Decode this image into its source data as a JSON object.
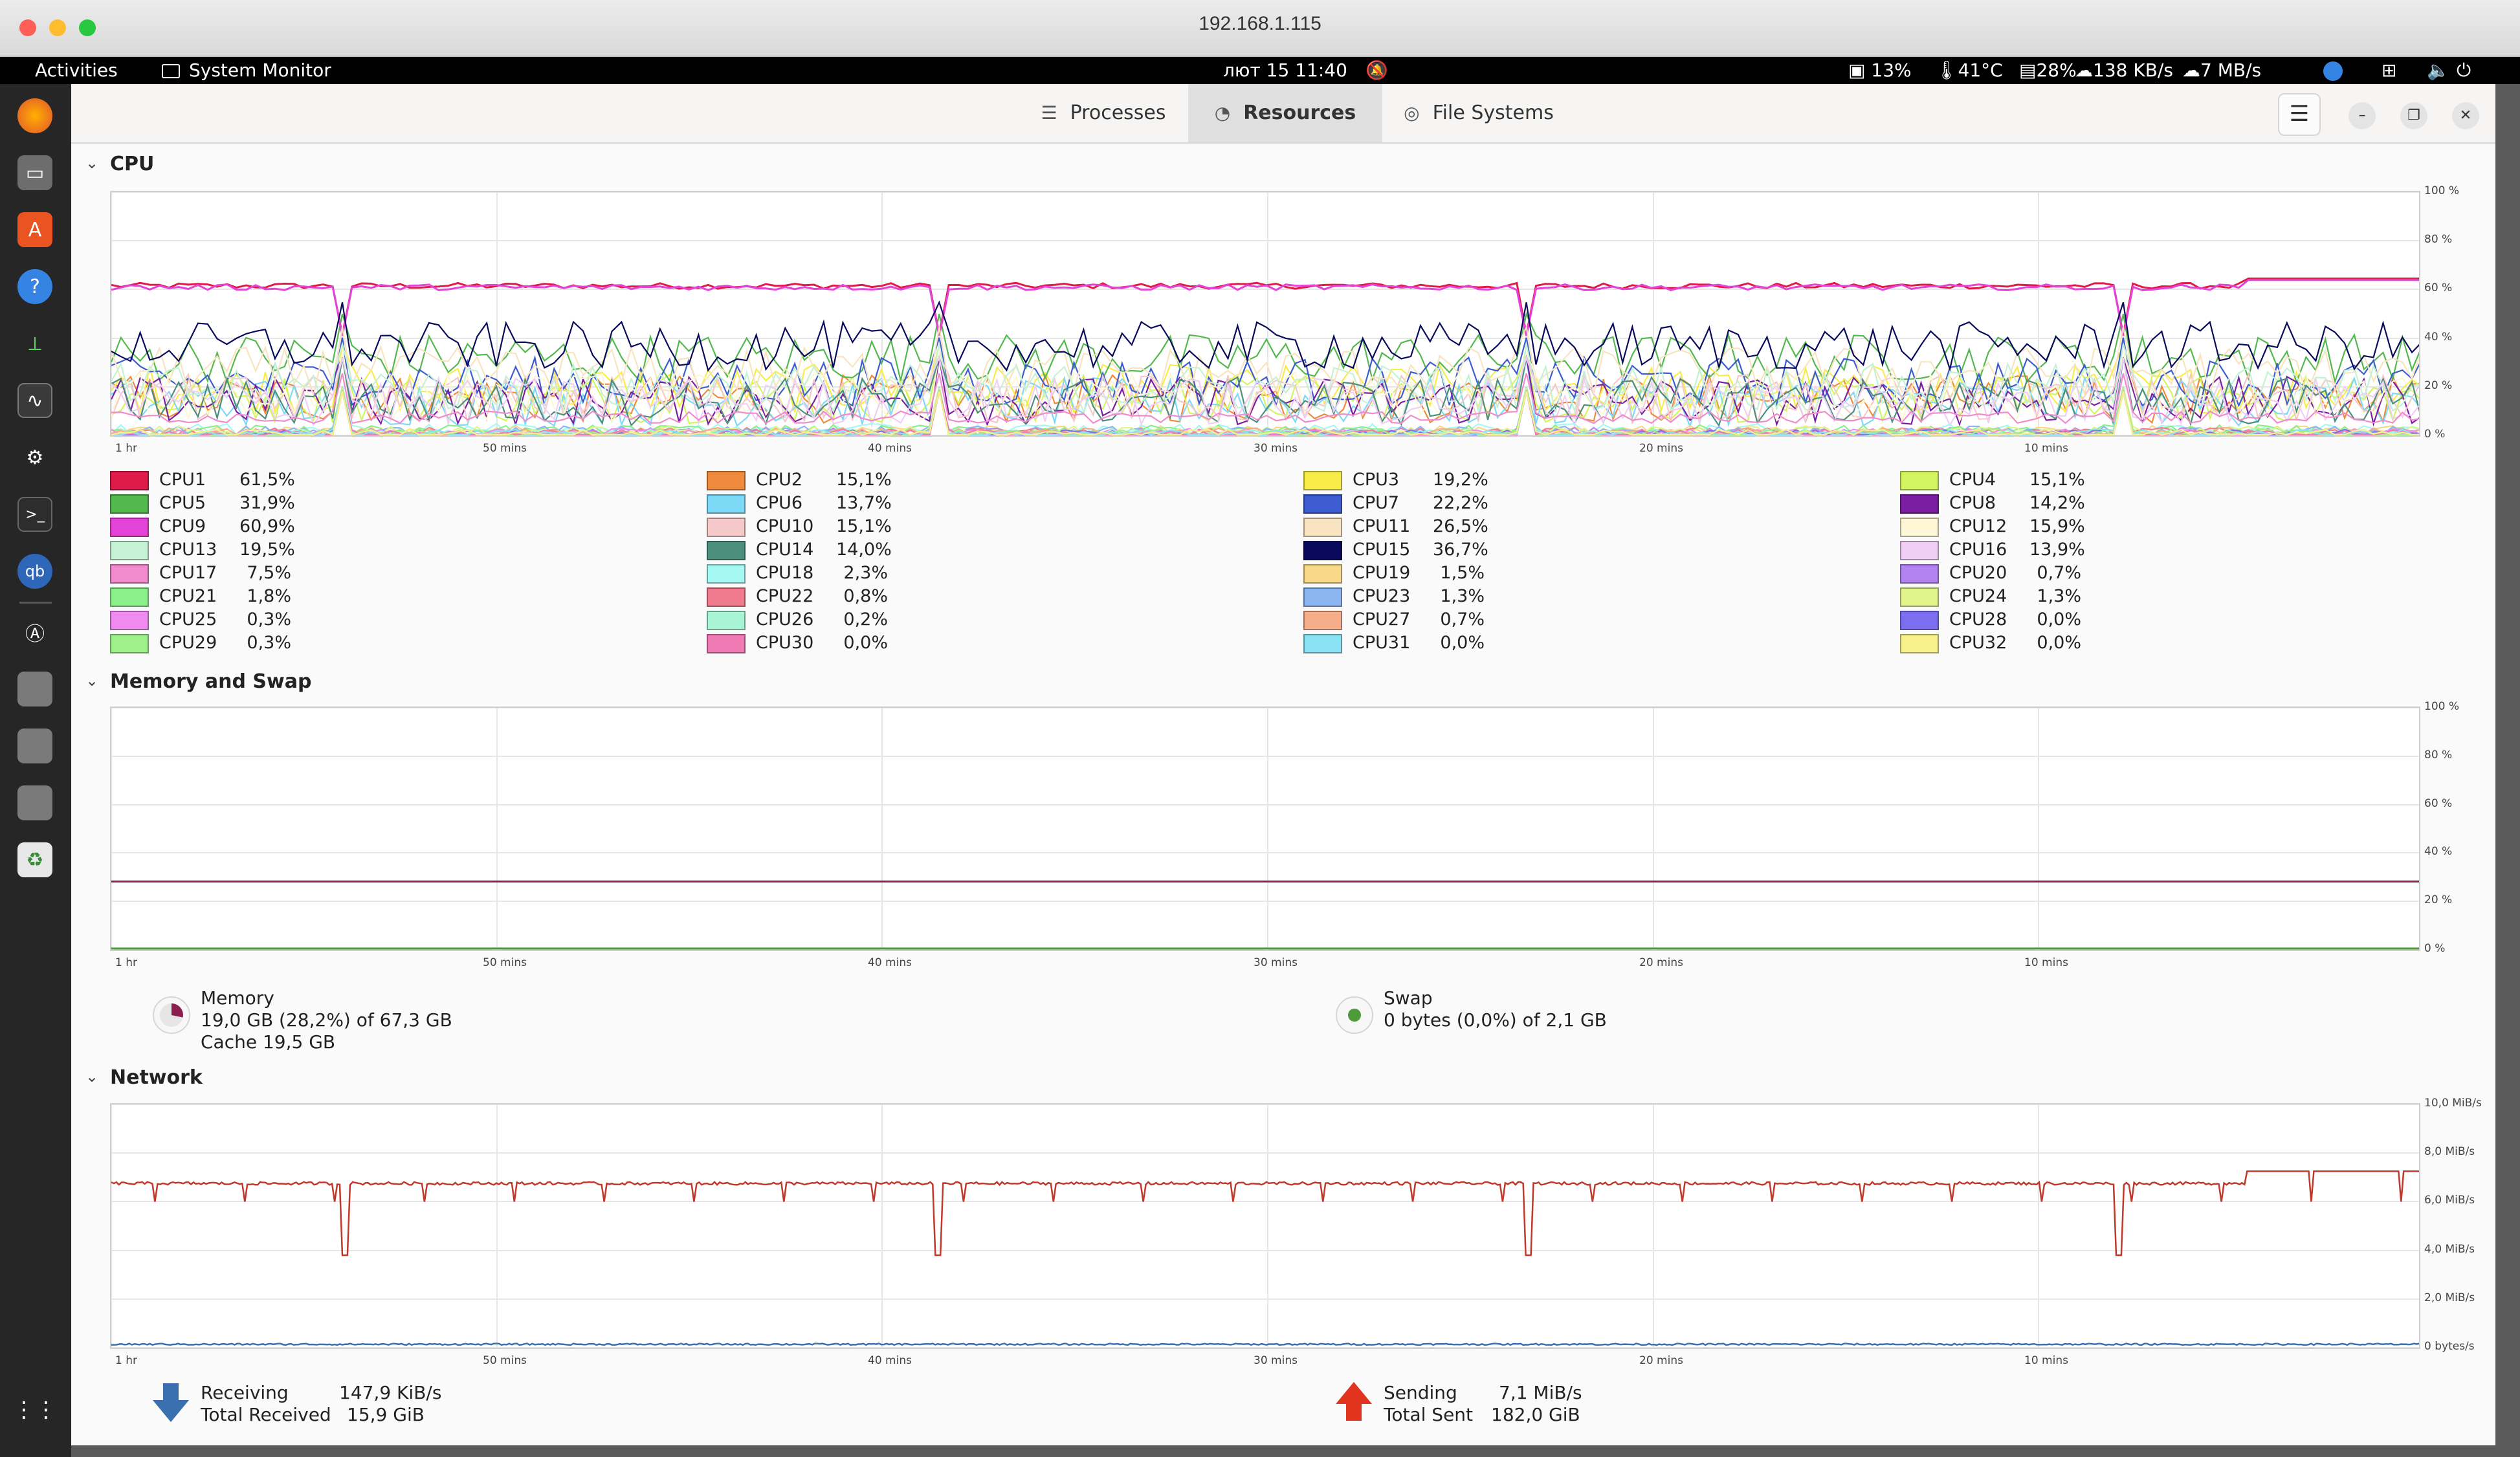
{
  "mac_window": {
    "title": "192.168.1.115"
  },
  "topbar": {
    "activities": "Activities",
    "app_name": "System Monitor",
    "datetime": "лют 15  11:40",
    "indicators": {
      "disk": "13%",
      "temp": "41°C",
      "cpu": "28%",
      "net_down": "138 KB/s",
      "net_up": "7 MB/s"
    }
  },
  "tabs": [
    {
      "label": "Processes"
    },
    {
      "label": "Resources"
    },
    {
      "label": "File Systems"
    }
  ],
  "cpu": {
    "title": "CPU",
    "y_ticks": [
      "100 %",
      "80 %",
      "60 %",
      "40 %",
      "20 %",
      "0 %"
    ],
    "x_ticks": [
      "1 hr",
      "50 mins",
      "40 mins",
      "30 mins",
      "20 mins",
      "10 mins"
    ],
    "cores": [
      {
        "name": "CPU1",
        "value": "61,5%",
        "color": "#e01b4c"
      },
      {
        "name": "CPU2",
        "value": "15,1%",
        "color": "#f08a3c"
      },
      {
        "name": "CPU3",
        "value": "19,2%",
        "color": "#f8ed48"
      },
      {
        "name": "CPU4",
        "value": "15,1%",
        "color": "#d2f560"
      },
      {
        "name": "CPU5",
        "value": "31,9%",
        "color": "#53b84d"
      },
      {
        "name": "CPU6",
        "value": "13,7%",
        "color": "#7ed9f7"
      },
      {
        "name": "CPU7",
        "value": "22,2%",
        "color": "#3c5cd0"
      },
      {
        "name": "CPU8",
        "value": "14,2%",
        "color": "#7a1fa2"
      },
      {
        "name": "CPU9",
        "value": "60,9%",
        "color": "#e343d6"
      },
      {
        "name": "CPU10",
        "value": "15,1%",
        "color": "#f5c9c9"
      },
      {
        "name": "CPU11",
        "value": "26,5%",
        "color": "#f8e4c0"
      },
      {
        "name": "CPU12",
        "value": "15,9%",
        "color": "#fdf7d6"
      },
      {
        "name": "CPU13",
        "value": "19,5%",
        "color": "#c5f2d4"
      },
      {
        "name": "CPU14",
        "value": "14,0%",
        "color": "#4c8f7d"
      },
      {
        "name": "CPU15",
        "value": "36,7%",
        "color": "#0a0a5c"
      },
      {
        "name": "CPU16",
        "value": "13,9%",
        "color": "#f0cff5"
      },
      {
        "name": "CPU17",
        "value": "7,5%",
        "color": "#f08ccd"
      },
      {
        "name": "CPU18",
        "value": "2,3%",
        "color": "#a6f8f5"
      },
      {
        "name": "CPU19",
        "value": "1,5%",
        "color": "#f8d98a"
      },
      {
        "name": "CPU20",
        "value": "0,7%",
        "color": "#b383f2"
      },
      {
        "name": "CPU21",
        "value": "1,8%",
        "color": "#8cf08a"
      },
      {
        "name": "CPU22",
        "value": "0,8%",
        "color": "#f07b8e"
      },
      {
        "name": "CPU23",
        "value": "1,3%",
        "color": "#8cb6f0"
      },
      {
        "name": "CPU24",
        "value": "1,3%",
        "color": "#e2f58c"
      },
      {
        "name": "CPU25",
        "value": "0,3%",
        "color": "#f08af0"
      },
      {
        "name": "CPU26",
        "value": "0,2%",
        "color": "#a8f5d5"
      },
      {
        "name": "CPU27",
        "value": "0,7%",
        "color": "#f5ad8a"
      },
      {
        "name": "CPU28",
        "value": "0,0%",
        "color": "#7b6ff0"
      },
      {
        "name": "CPU29",
        "value": "0,3%",
        "color": "#9ef08a"
      },
      {
        "name": "CPU30",
        "value": "0,0%",
        "color": "#f07ab4"
      },
      {
        "name": "CPU31",
        "value": "0,0%",
        "color": "#8ae2f5"
      },
      {
        "name": "CPU32",
        "value": "0,0%",
        "color": "#f8f08a"
      }
    ]
  },
  "memory": {
    "title": "Memory and Swap",
    "y_ticks": [
      "100 %",
      "80 %",
      "60 %",
      "40 %",
      "20 %",
      "0 %"
    ],
    "x_ticks": [
      "1 hr",
      "50 mins",
      "40 mins",
      "30 mins",
      "20 mins",
      "10 mins"
    ],
    "memory_label": "Memory",
    "memory_used": "19,0 GB (28,2%) of 67,3 GB",
    "cache": "Cache 19,5 GB",
    "swap_label": "Swap",
    "swap_used": "0 bytes (0,0%) of 2,1 GB",
    "memory_color": "#8a1f4f",
    "swap_color": "#4c9a3a",
    "memory_percent": 28.2,
    "swap_percent": 0.0
  },
  "network": {
    "title": "Network",
    "y_ticks": [
      "10,0 MiB/s",
      "8,0 MiB/s",
      "6,0 MiB/s",
      "4,0 MiB/s",
      "2,0 MiB/s",
      "0 bytes/s"
    ],
    "x_ticks": [
      "1 hr",
      "50 mins",
      "40 mins",
      "30 mins",
      "20 mins",
      "10 mins"
    ],
    "receiving_label": "Receiving",
    "receiving_value": "147,9 KiB/s",
    "total_received_label": "Total Received",
    "total_received_value": "15,9 GiB",
    "sending_label": "Sending",
    "sending_value": "7,1 MiB/s",
    "total_sent_label": "Total Sent",
    "total_sent_value": "182,0 GiB",
    "receive_color": "#3a6fb0",
    "send_color": "#c0392b"
  }
}
